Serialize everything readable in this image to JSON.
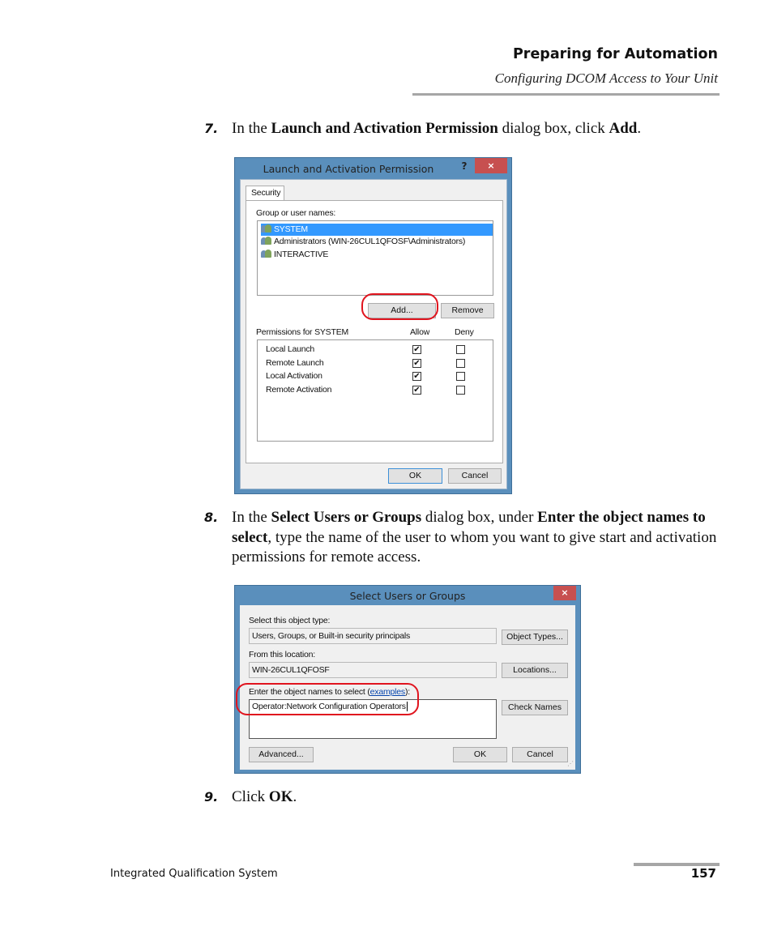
{
  "header": {
    "chapter_title": "Preparing for Automation",
    "section_title": "Configuring DCOM Access to Your Unit"
  },
  "steps": [
    {
      "number": "7.",
      "parts": [
        {
          "text": "In the ",
          "bold": false
        },
        {
          "text": "Launch and Activation Permission",
          "bold": true
        },
        {
          "text": " dialog box, click ",
          "bold": false
        },
        {
          "text": "Add",
          "bold": true
        },
        {
          "text": ".",
          "bold": false
        }
      ]
    },
    {
      "number": "8.",
      "parts": [
        {
          "text": "In the ",
          "bold": false
        },
        {
          "text": "Select Users or Groups",
          "bold": true
        },
        {
          "text": " dialog box, under ",
          "bold": false
        },
        {
          "text": "Enter the object names to select",
          "bold": true
        },
        {
          "text": ", type the name of the user to whom you want to give start and activation permissions for remote access.",
          "bold": false
        }
      ]
    },
    {
      "number": "9.",
      "parts": [
        {
          "text": "Click ",
          "bold": false
        },
        {
          "text": "OK",
          "bold": true
        },
        {
          "text": ".",
          "bold": false
        }
      ]
    }
  ],
  "dialog1": {
    "title": "Launch and Activation Permission",
    "help_label": "?",
    "close_label": "×",
    "tab_label": "Security",
    "group_label": "Group or user names:",
    "users": [
      {
        "name": "SYSTEM",
        "selected": true,
        "icon": "user-group-icon"
      },
      {
        "name": "Administrators (WIN-26CUL1QFOSF\\Administrators)",
        "selected": false,
        "icon": "user-group-icon"
      },
      {
        "name": "INTERACTIVE",
        "selected": false,
        "icon": "user-group-icon"
      }
    ],
    "add_label": "Add...",
    "remove_label": "Remove",
    "permissions_label": "Permissions for SYSTEM",
    "allow_label": "Allow",
    "deny_label": "Deny",
    "permissions": [
      {
        "name": "Local Launch",
        "allow": true,
        "deny": false
      },
      {
        "name": "Remote Launch",
        "allow": true,
        "deny": false
      },
      {
        "name": "Local Activation",
        "allow": true,
        "deny": false
      },
      {
        "name": "Remote Activation",
        "allow": true,
        "deny": false
      }
    ],
    "ok_label": "OK",
    "cancel_label": "Cancel"
  },
  "dialog2": {
    "title": "Select Users or Groups",
    "close_label": "×",
    "object_type_label": "Select this object type:",
    "object_type_value": "Users, Groups, or Built-in security principals",
    "object_types_button": "Object Types...",
    "location_label": "From this location:",
    "location_value": "WIN-26CUL1QFOSF",
    "locations_button": "Locations...",
    "names_label_prefix": "Enter the object names to select (",
    "names_label_link": "examples",
    "names_label_suffix": "):",
    "names_value": "Operator:Network Configuration Operators",
    "check_names_button": "Check Names",
    "advanced_button": "Advanced...",
    "ok_label": "OK",
    "cancel_label": "Cancel"
  },
  "footer": {
    "product": "Integrated Qualification System",
    "page_number": "157"
  }
}
